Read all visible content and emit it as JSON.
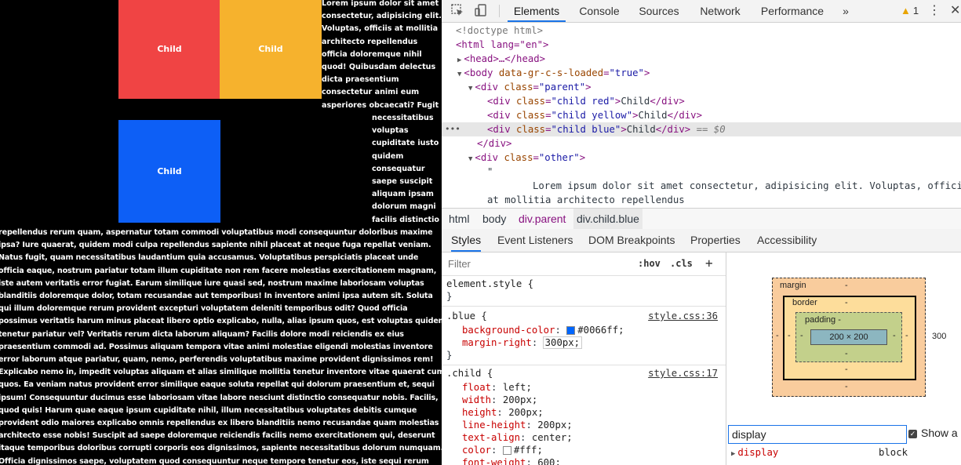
{
  "preview": {
    "child_red_label": "Child",
    "child_yellow_label": "Child",
    "child_blue_label": "Child",
    "top_lines": [
      "Lorem ipsum dolor sit amet",
      "consectetur, adipisicing elit.",
      "Voluptas, officiis at mollitia",
      "architecto repellendus",
      "officia doloremque nihil",
      "quod! Quibusdam delectus",
      "dicta praesentium",
      "consectetur animi eum",
      "asperiores obcaecati? Fugit"
    ],
    "mid_lines": [
      "necessitatibus",
      "voluptas",
      "cupiditate iusto",
      "quidem",
      "consequatur",
      "saepe suscipit",
      "aliquam ipsam",
      "dolorum magni",
      "facilis distinctio"
    ],
    "bottom_lines": [
      "repellendus rerum quam, aspernatur totam commodi voluptatibus modi consequuntur doloribus maxime",
      "ipsa? Iure quaerat, quidem modi culpa repellendus sapiente nihil placeat at neque fuga repellat veniam.",
      "Natus fugit, quam necessitatibus laudantium quia accusamus. Voluptatibus perspiciatis placeat unde",
      "officia eaque, nostrum pariatur totam illum cupiditate non rem facere molestias exercitationem magnam,",
      "iste autem veritatis error fugiat. Earum similique iure quasi sed, nostrum maxime laboriosam voluptas",
      "blanditiis doloremque dolor, totam recusandae aut temporibus! In inventore animi ipsa autem sit. Soluta",
      "qui illum doloremque rerum provident excepturi voluptatem deleniti temporibus odit? Quod officia",
      "possimus veritatis harum minus placeat libero optio explicabo, nulla, alias ipsum quos, est voluptas quidem",
      "tenetur pariatur vel? Veritatis rerum dicta laborum aliquam? Facilis dolore modi reiciendis ex eius",
      "praesentium commodi ad. Possimus aliquam tempora vitae animi molestiae eligendi molestias inventore",
      "error laborum atque pariatur, quam, nemo, perferendis voluptatibus maxime provident dignissimos rem!",
      "Explicabo nemo in, impedit voluptas aliquam et alias similique mollitia tenetur inventore vitae quaerat cum",
      "quos. Ea veniam natus provident error similique eaque soluta repellat qui dolorum praesentium et, sequi",
      "ipsum! Consequuntur ducimus esse laboriosam vitae labore nesciunt distinctio consequatur nobis. Facilis,",
      "quod quis! Harum quae eaque ipsum cupiditate nihil, illum necessitatibus voluptates debitis cumque",
      "provident odio maiores explicabo omnis repellendus ex libero blanditiis nemo recusandae quam molestias",
      "architecto esse nobis! Suscipit ad saepe doloremque reiciendis facilis nemo exercitationem qui, deserunt",
      "itaque temporibus doloribus corrupti corporis eos dignissimos, sapiente necessitatibus dolorum numquam.",
      "Officia dignissimos saepe, voluptatem quod consequuntur neque tempore tenetur eos, iste sequi rerum"
    ]
  },
  "devtools": {
    "tabs": [
      "Elements",
      "Console",
      "Sources",
      "Network",
      "Performance"
    ],
    "more_tabs": "»",
    "warning_count": "1",
    "dom": {
      "doctype": "<!doctype html>",
      "html_open": "<html lang=\"en\">",
      "head": "<head>…</head>",
      "body_attr_name": "data-gr-c-s-loaded",
      "body_attr_value": "\"true\"",
      "div_parent_class": "\"parent\"",
      "red_class": "\"child red\"",
      "yellow_class": "\"child yellow\"",
      "blue_class": "\"child blue\"",
      "child_text": "Child",
      "eq_ref": "== $0",
      "div_close": "</div>",
      "other_class": "\"other\"",
      "quote": "\"",
      "text_line1": "Lorem ipsum dolor sit amet consectetur, adipisicing elit. Voluptas, officiis",
      "text_line2": "at mollitia architecto repellendus"
    },
    "breadcrumbs": [
      "html",
      "body",
      "div.parent",
      "div.child.blue"
    ],
    "subtabs": [
      "Styles",
      "Event Listeners",
      "DOM Breakpoints",
      "Properties",
      "Accessibility"
    ],
    "filter_placeholder": "Filter",
    "hov": ":hov",
    "cls": ".cls",
    "plus": "+",
    "styles": {
      "element_style": "element.style {",
      "close": "}",
      "blue_selector": ".blue {",
      "blue_source": "style.css:36",
      "blue_props": [
        {
          "name": "background-color",
          "value": "#0066ff;"
        },
        {
          "name": "margin-right",
          "value": "300px;"
        }
      ],
      "child_selector": ".child {",
      "child_source": "style.css:17",
      "child_props": [
        {
          "name": "float",
          "value": "left;"
        },
        {
          "name": "width",
          "value": "200px;"
        },
        {
          "name": "height",
          "value": "200px;"
        },
        {
          "name": "line-height",
          "value": "200px;"
        },
        {
          "name": "text-align",
          "value": "center;"
        },
        {
          "name": "color",
          "value": "#fff;"
        },
        {
          "name": "font-weight",
          "value": "600;"
        }
      ],
      "swatch_blue": "#0066ff",
      "swatch_white": "#ffffff"
    },
    "box_model": {
      "margin_label": "margin",
      "border_label": "border",
      "padding_label": "padding -",
      "content": "200 × 200",
      "dash": "-",
      "margin_right": "300"
    },
    "computed": {
      "filter_value": "display",
      "show_all": "Show a",
      "prop": "display",
      "value": "block"
    }
  }
}
